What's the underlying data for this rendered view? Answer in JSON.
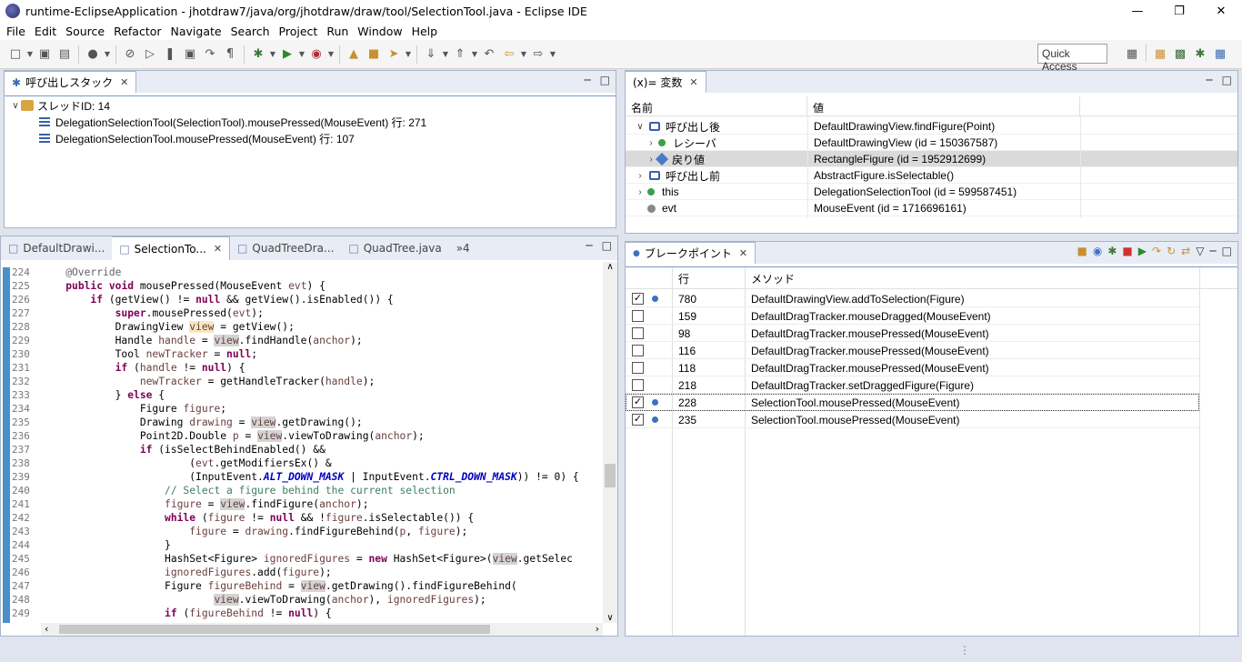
{
  "window": {
    "title": "runtime-EclipseApplication - jhotdraw7/java/org/jhotdraw/draw/tool/SelectionTool.java - Eclipse IDE"
  },
  "menu": [
    "File",
    "Edit",
    "Source",
    "Refactor",
    "Navigate",
    "Search",
    "Project",
    "Run",
    "Window",
    "Help"
  ],
  "toolbar": {
    "quick_access": "Quick Access"
  },
  "callstack": {
    "tab": "呼び出しスタック",
    "thread": "スレッドID: 14",
    "frames": [
      "DelegationSelectionTool(SelectionTool).mousePressed(MouseEvent) 行: 271",
      "DelegationSelectionTool.mousePressed(MouseEvent) 行: 107"
    ]
  },
  "variables": {
    "tab": "(x)= 変数",
    "col_name": "名前",
    "col_value": "値",
    "rows": [
      {
        "name": "呼び出し後",
        "value": "DefaultDrawingView.findFigure(Point)"
      },
      {
        "name": "レシーバ",
        "value": "DefaultDrawingView (id = 150367587)"
      },
      {
        "name": "戻り値",
        "value": "RectangleFigure (id = 1952912699)"
      },
      {
        "name": "呼び出し前",
        "value": "AbstractFigure.isSelectable()"
      },
      {
        "name": "this",
        "value": "DelegationSelectionTool (id = 599587451)"
      },
      {
        "name": "evt",
        "value": "MouseEvent (id = 1716696161)"
      }
    ]
  },
  "editor": {
    "tabs": [
      "DefaultDrawi...",
      "SelectionTo...",
      "QuadTreeDra...",
      "QuadTree.java"
    ],
    "overflow": "»4",
    "line_numbers": [
      "224",
      "225",
      "226",
      "227",
      "228",
      "229",
      "230",
      "231",
      "232",
      "233",
      "234",
      "235",
      "236",
      "237",
      "238",
      "239",
      "240",
      "241",
      "242",
      "243",
      "244",
      "245",
      "246",
      "247",
      "248",
      "249"
    ]
  },
  "breakpoints": {
    "tab": "ブレークポイント",
    "col_line": "行",
    "col_method": "メソッド",
    "rows": [
      {
        "checked": true,
        "line": "780",
        "method": "DefaultDrawingView.addToSelection(Figure)"
      },
      {
        "checked": false,
        "line": "159",
        "method": "DefaultDragTracker.mouseDragged(MouseEvent)"
      },
      {
        "checked": false,
        "line": "98",
        "method": "DefaultDragTracker.mousePressed(MouseEvent)"
      },
      {
        "checked": false,
        "line": "116",
        "method": "DefaultDragTracker.mousePressed(MouseEvent)"
      },
      {
        "checked": false,
        "line": "118",
        "method": "DefaultDragTracker.mousePressed(MouseEvent)"
      },
      {
        "checked": false,
        "line": "218",
        "method": "DefaultDragTracker.setDraggedFigure(Figure)"
      },
      {
        "checked": true,
        "line": "228",
        "method": "SelectionTool.mousePressed(MouseEvent)"
      },
      {
        "checked": true,
        "line": "235",
        "method": "SelectionTool.mousePressed(MouseEvent)"
      }
    ]
  }
}
